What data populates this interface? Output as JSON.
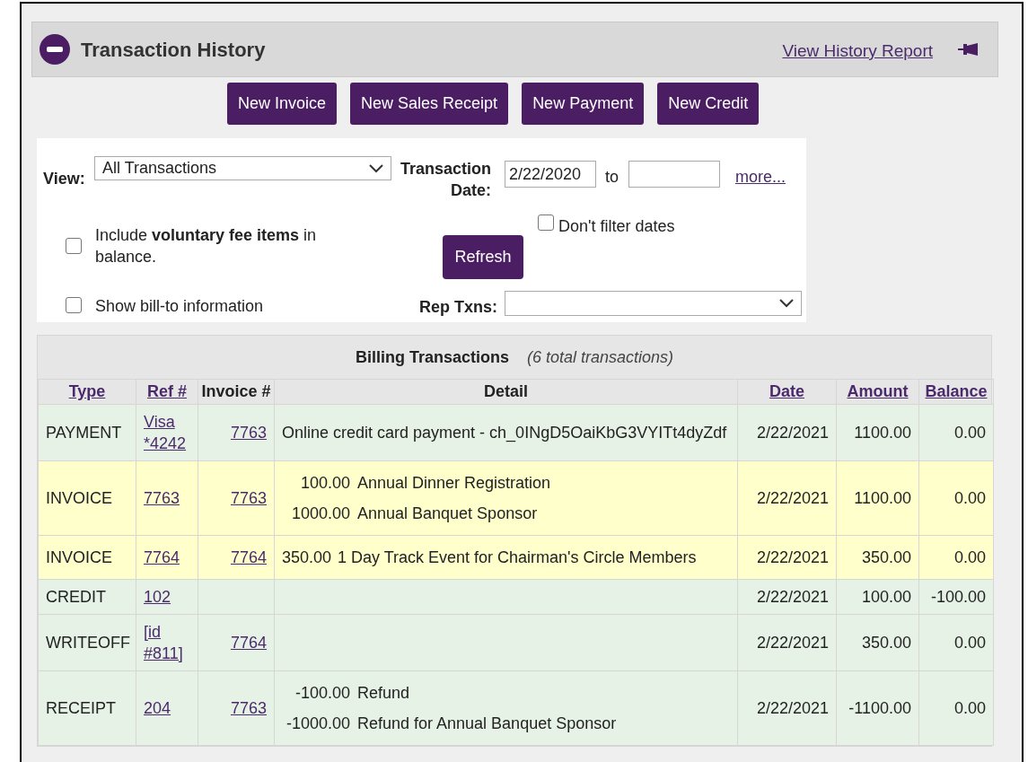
{
  "panel": {
    "title": "Transaction History",
    "report_link": "View History Report"
  },
  "buttons": [
    "New Invoice",
    "New Sales Receipt",
    "New Payment",
    "New Credit"
  ],
  "filters": {
    "view_label": "View:",
    "view_value": "All Transactions",
    "date_label_1": "Transaction",
    "date_label_2": "Date:",
    "date_from": "2/22/2020",
    "to_label": "to",
    "more_link": "more...",
    "dont_filter": {
      "label": "Don't filter dates",
      "checked": false
    },
    "voluntary": {
      "label": "Include **voluntary fee items** in balance.",
      "checked": false
    },
    "refresh": "Refresh",
    "bill_to": {
      "label": "Show bill-to information",
      "checked": false
    },
    "rep_label": "Rep Txns:"
  },
  "table": {
    "title": "Billing Transactions",
    "count": "(6 total transactions)",
    "columns": [
      {
        "label": "Type",
        "link": true
      },
      {
        "label": "Ref #",
        "link": true
      },
      {
        "label": "Invoice #",
        "link": false
      },
      {
        "label": "Detail",
        "link": false
      },
      {
        "label": "Date",
        "link": true
      },
      {
        "label": "Amount",
        "link": true
      },
      {
        "label": "Balance",
        "link": true
      }
    ],
    "rows": [
      {
        "kind": "payment",
        "type": "PAYMENT",
        "ref": "Visa *4242",
        "invoice": "7763",
        "detail": "Online credit card payment - ch_0INgD5OaiKbG3VYITt4dyZdf",
        "date": "2/22/2021",
        "amount": "1100.00",
        "balance": "0.00"
      },
      {
        "kind": "invoice",
        "type": "INVOICE",
        "ref": "7763",
        "invoice": "7763",
        "lines": [
          {
            "amount": "100.00",
            "text": "Annual Dinner Registration"
          },
          {
            "amount": "1000.00",
            "text": "Annual Banquet Sponsor"
          }
        ],
        "date": "2/22/2021",
        "amount": "1100.00",
        "balance": "0.00"
      },
      {
        "kind": "invoice",
        "type": "INVOICE",
        "ref": "7764",
        "invoice": "7764",
        "lines": [
          {
            "amount": "350.00",
            "text": "1 Day Track Event for Chairman's Circle Members"
          }
        ],
        "date": "2/22/2021",
        "amount": "350.00",
        "balance": "0.00"
      },
      {
        "kind": "credit",
        "type": "CREDIT",
        "ref": "102",
        "date": "2/22/2021",
        "amount": "100.00",
        "balance": "-100.00"
      },
      {
        "kind": "writeoff",
        "type": "WRITEOFF",
        "ref": "[id #811]",
        "invoice": "7764",
        "date": "2/22/2021",
        "amount": "350.00",
        "balance": "0.00"
      },
      {
        "kind": "receipt",
        "type": "RECEIPT",
        "ref": "204",
        "invoice": "7763",
        "lines": [
          {
            "amount": "-100.00",
            "text": "Refund"
          },
          {
            "amount": "-1000.00",
            "text": "Refund for Annual Banquet Sponsor"
          }
        ],
        "date": "2/22/2021",
        "amount": "-1100.00",
        "balance": "0.00"
      }
    ]
  }
}
